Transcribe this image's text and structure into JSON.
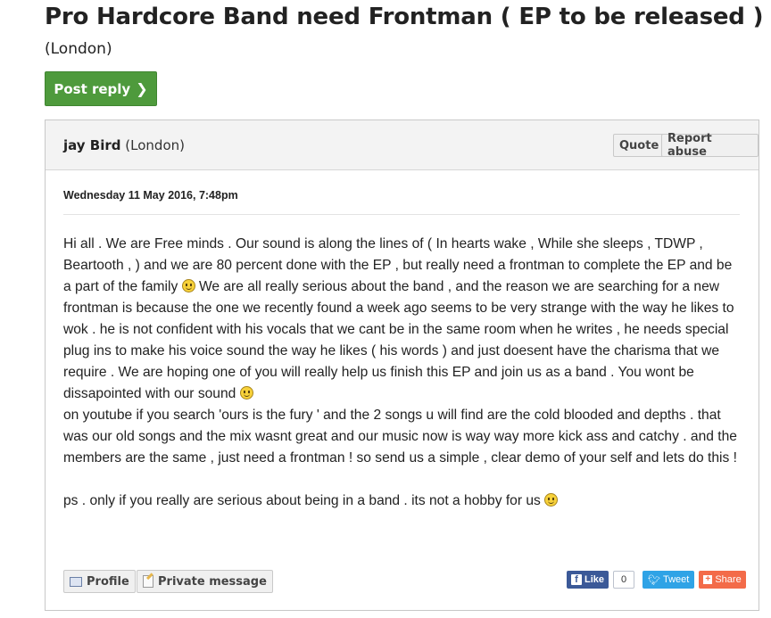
{
  "thread": {
    "title": "Pro Hardcore Band need Frontman ( EP to be released )",
    "location": "(London)",
    "post_reply_label": "Post reply"
  },
  "post": {
    "author_name": "jay Bird",
    "author_location": "(London)",
    "quote_label": "Quote",
    "report_label": "Report abuse",
    "date": "Wednesday 11 May 2016, 7:48pm",
    "body": {
      "p1_a": "Hi all . We are Free minds . Our sound is along the lines of ( In hearts wake , While she sleeps , TDWP , Beartooth , ) and we are 80 percent done with the EP , but really need a frontman to complete the EP and be a part of the family ",
      "p1_b": " We are all really serious about the band , and the reason we are searching for a new frontman is because the one we recently found a week ago seems to be very strange with the way he likes to wok . he is not confident with his vocals that we cant be in the same room when he writes , he needs special plug ins to make his voice sound the way he likes ( his words ) and just doesent have the charisma that we require . We are hoping one of you will really help us finish this EP and join us as a band . You wont be dissapointed with our sound ",
      "p2": "on youtube if you search 'ours is the fury ' and the 2 songs u will find are the cold blooded and depths . that was our old songs and the mix wasnt great and our music now is way way more kick ass and catchy . and the members are the same , just need a frontman ! so send us a simple , clear demo of your self and lets do this !",
      "p3": "ps . only if you really are serious about being in a band . its not a hobby for us "
    },
    "profile_label": "Profile",
    "pm_label": "Private message",
    "share": {
      "like_label": "Like",
      "like_count": "0",
      "tweet_label": "Tweet",
      "share_label": "Share"
    }
  },
  "icons": {
    "chevron": "chevron-right-icon",
    "smiley": "smiley-icon",
    "profile": "profile-card-icon",
    "pm": "pencil-note-icon",
    "facebook": "facebook-icon",
    "twitter": "twitter-bird-icon",
    "share": "plus-share-icon"
  },
  "colors": {
    "post_reply_bg": "#4e9a3c",
    "facebook": "#3b5998",
    "twitter": "#2fa3e6",
    "share": "#f36b49"
  }
}
